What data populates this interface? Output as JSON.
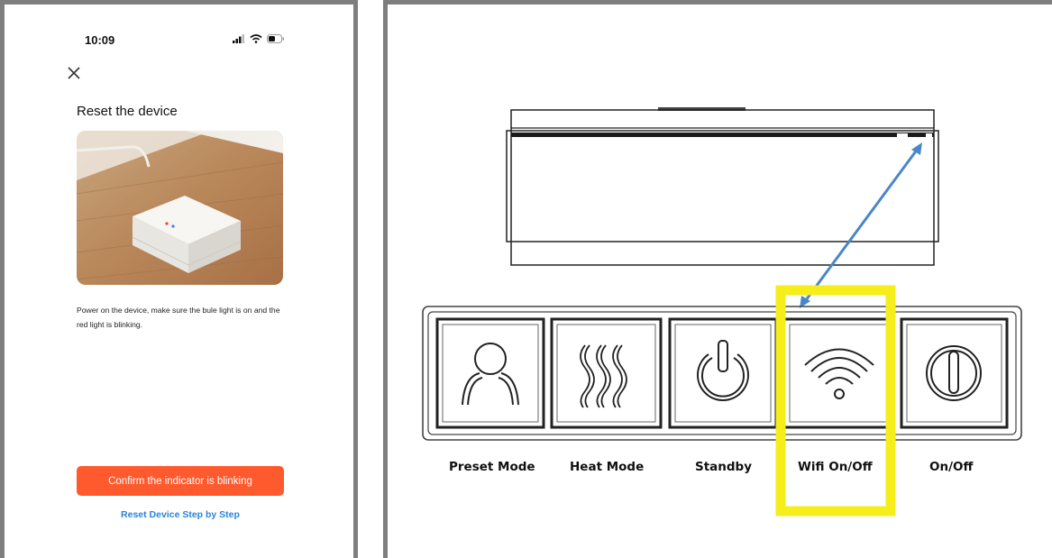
{
  "phone": {
    "status_time": "10:09",
    "icons": [
      "signal-icon",
      "wifi-icon",
      "battery-icon"
    ],
    "close_icon": "close-icon",
    "title": "Reset the device",
    "description": "Power on the device, make sure the bule light is on and the red light is blinking.",
    "confirm_label": "Confirm the indicator is blinking",
    "reset_link": "Reset Device Step by Step",
    "accent_color": "#ff5a2e",
    "link_color": "#2a84d8"
  },
  "diagram": {
    "buttons": [
      {
        "label": "Preset Mode",
        "icon": "person-icon"
      },
      {
        "label": "Heat Mode",
        "icon": "heat-waves-icon"
      },
      {
        "label": "Standby",
        "icon": "standby-power-icon"
      },
      {
        "label": "Wifi On/Off",
        "icon": "wifi-icon"
      },
      {
        "label": "On/Off",
        "icon": "on-off-icon"
      }
    ],
    "highlight_color": "#f5ee1a",
    "arrow_color": "#4a87c8"
  }
}
